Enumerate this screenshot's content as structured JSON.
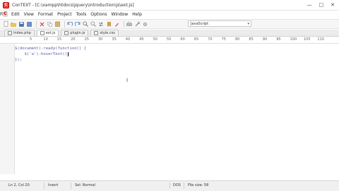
{
  "window": {
    "app_icon_letter": "C",
    "title": "ConTEXT - [C:\\xampp\\htdocs\\jquery\\introduction\\js\\ext.js]",
    "controls": [
      "—",
      "□",
      "✕"
    ]
  },
  "menu": {
    "logo_letter": "C",
    "items": [
      "File",
      "Edit",
      "View",
      "Format",
      "Project",
      "Tools",
      "Options",
      "Window",
      "Help"
    ]
  },
  "toolbar": {
    "language": "JavaScript",
    "dropdown_arrow": "▾"
  },
  "tabs": [
    {
      "label": "index.php",
      "active": false
    },
    {
      "label": "ext.js",
      "active": true
    },
    {
      "label": "plugin.js",
      "active": false
    },
    {
      "label": "style.css",
      "active": false
    }
  ],
  "ruler": {
    "ticks": [
      "5",
      "10",
      "15",
      "20",
      "25",
      "30",
      "35",
      "40",
      "45",
      "50",
      "55",
      "60",
      "65",
      "70",
      "75",
      "80",
      "85",
      "90",
      "95",
      "100",
      "105",
      "110"
    ]
  },
  "editor": {
    "lines": [
      "$(document).ready(function() {",
      "    $('a').hoverText();",
      "});"
    ]
  },
  "status": {
    "position": "Ln 2, Col 20",
    "mode": "Insert",
    "sel": "Sel: Normal",
    "encoding": "DOS",
    "filesize": "File size: 58"
  }
}
